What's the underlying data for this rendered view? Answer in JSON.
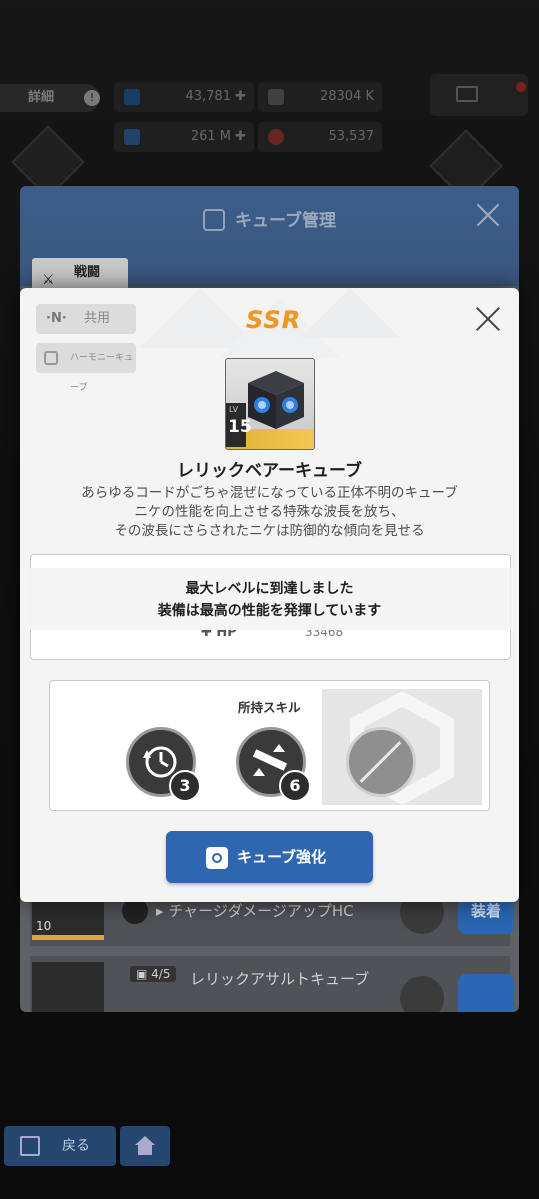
{
  "topbar": {
    "detail_label": "詳細",
    "info_icon": "info-icon",
    "stats": [
      {
        "value": "43,781 ✚",
        "icon": "gem-icon"
      },
      {
        "value": "28304 K",
        "icon": "battery-icon"
      },
      {
        "value": "261 M ✚",
        "icon": "key-icon"
      },
      {
        "value": "53,537",
        "icon": "coin-icon"
      }
    ]
  },
  "manager": {
    "title": "キューブ管理",
    "tab_label": "戦闘",
    "rows": [
      {
        "level": "10",
        "text": "チャージダメージアップHC",
        "equip_label": "装着"
      },
      {
        "count": "4/5",
        "text": "レリックアサルトキューブ",
        "equip_label": ""
      }
    ]
  },
  "popup": {
    "shared_badge": "共用",
    "shared_letter": "·N·",
    "type_badge": "ハーモニーキューブ",
    "rarity": "SSR",
    "cube_level_prefix": "LV",
    "cube_level": "15",
    "cube_name": "レリックベアーキューブ",
    "description": [
      "あらゆるコードがごちゃ混ぜになっている正体不明のキューブ",
      "ニケの性能を向上させる特殊な波長を放ち、",
      "その波長にさらされたニケは防御的な傾向を見せる"
    ],
    "stat_label": "✚ HP",
    "stat_value": "33468",
    "max_level_line1": "最大レベルに到達しました",
    "max_level_line2": "装備は最高の性能を発揮しています",
    "skills_title": "所持スキル",
    "skills": [
      {
        "icon": "clock-cycle-icon",
        "level": "3"
      },
      {
        "icon": "weapon-upgrade-icon",
        "level": "6"
      }
    ],
    "locked_skill_icon": "locked-slot-icon",
    "upgrade_button": "キューブ強化"
  },
  "nav": {
    "back_label": "戻る"
  },
  "colors": {
    "ssr_orange": "#f09623",
    "primary_blue": "#2f66b0",
    "gold_stripe": "#e0b23d"
  }
}
